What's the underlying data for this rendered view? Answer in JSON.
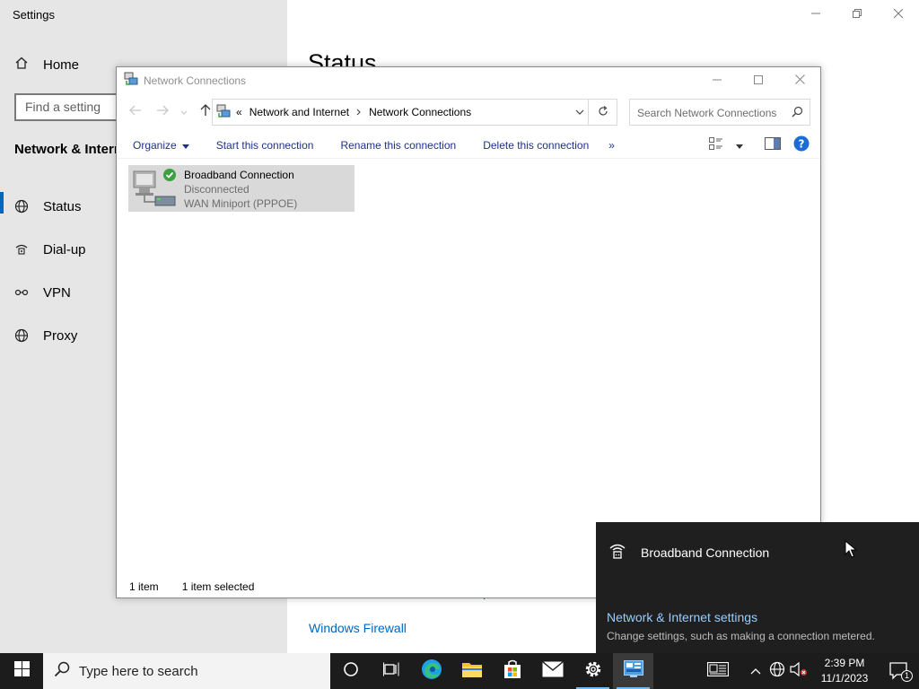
{
  "settings": {
    "app_title": "Settings",
    "home_label": "Home",
    "search_placeholder": "Find a setting",
    "section_title": "Network & Internet",
    "nav": [
      {
        "label": "Status",
        "icon": "globe-icon"
      },
      {
        "label": "Dial-up",
        "icon": "dialup-icon"
      },
      {
        "label": "VPN",
        "icon": "vpn-icon"
      },
      {
        "label": "Proxy",
        "icon": "globe-icon"
      }
    ],
    "page_heading": "Status",
    "firewall_link": "Windows Firewall",
    "obscured_text": "p"
  },
  "netwin": {
    "title": "Network Connections",
    "breadcrumb": {
      "root": "«",
      "parent": "Network and Internet",
      "current": "Network Connections"
    },
    "search_placeholder": "Search Network Connections",
    "commands": {
      "organize": "Organize",
      "start": "Start this connection",
      "rename": "Rename this connection",
      "delete": "Delete this connection",
      "more": "»"
    },
    "items": [
      {
        "name": "Broadband Connection",
        "status": "Disconnected",
        "device": "WAN Miniport (PPPOE)"
      }
    ],
    "status": {
      "count": "1 item",
      "selected": "1 item selected"
    }
  },
  "flyout": {
    "connection": "Broadband Connection",
    "settings_link": "Network & Internet settings",
    "settings_desc": "Change settings, such as making a connection metered."
  },
  "taskbar": {
    "search_placeholder": "Type here to search",
    "time": "2:39 PM",
    "date": "11/1/2023",
    "notification_count": "1"
  },
  "colors": {
    "accent": "#0067c0",
    "flyout_bg": "#1f1f1f",
    "flyout_link": "#99ccff",
    "taskbar_bg": "#1c1c1c"
  }
}
